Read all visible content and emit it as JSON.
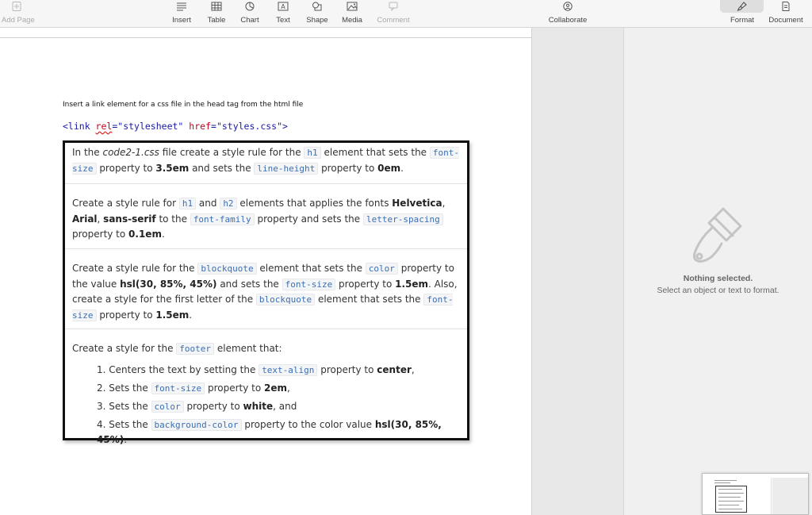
{
  "toolbar": {
    "add_page": "Add Page",
    "insert": "Insert",
    "table": "Table",
    "chart": "Chart",
    "text": "Text",
    "shape": "Shape",
    "media": "Media",
    "comment": "Comment",
    "collaborate": "Collaborate",
    "format": "Format",
    "document": "Document"
  },
  "document": {
    "instruction": "Insert a link element for a css file in the head tag from the html file",
    "code_line": {
      "open": "<link ",
      "attr1": "rel",
      "eq1": "=",
      "val1": "\"stylesheet\"",
      "space": " ",
      "attr2": "href",
      "eq2": "=",
      "val2": "\"styles.css\"",
      "close": ">"
    },
    "task1": {
      "t1": "In the ",
      "t2": "code2-1.css",
      "t3": " file create a style rule for the ",
      "c1": "h1",
      "t4": " element that sets the ",
      "c2": "font-size",
      "t5": " property to ",
      "b1": "3.5em",
      "t6": " and sets the ",
      "c3": "line-height",
      "t7": " property to ",
      "b2": "0em",
      "t8": "."
    },
    "task2": {
      "t1": "Create a style rule for ",
      "c1": "h1",
      "t2": " and ",
      "c2": "h2",
      "t3": " elements that applies the fonts ",
      "b1": "Helvetica",
      "t4": ", ",
      "b2": "Arial",
      "t5": ", ",
      "b3": "sans-serif",
      "t6": " to the ",
      "c3": "font-family",
      "t7": " property and sets the ",
      "c4": "letter-spacing",
      "t8": " property to ",
      "b4": "0.1em",
      "t9": "."
    },
    "task3": {
      "t1": "Create a style rule for the ",
      "c1": "blockquote",
      "t2": " element that sets the ",
      "c2": "color",
      "t3": " property to the value ",
      "b1": "hsl(30, 85%, 45%)",
      "t4": " and sets the ",
      "c3": "font-size",
      "t5": " property to ",
      "b2": "1.5em",
      "t6": ". Also, create a style for the first letter of the ",
      "c4": "blockquote",
      "t7": " element that sets the ",
      "c5": "font-size",
      "t8": " property to ",
      "b3": "1.5em",
      "t9": "."
    },
    "task4": {
      "t1": "Create a style for the ",
      "c1": "footer",
      "t2": " element that:",
      "steps": [
        {
          "num": "1. ",
          "t1": "Centers the text by setting the ",
          "c": "text-align",
          "t2": " property to ",
          "b": "center",
          "t3": ","
        },
        {
          "num": "2. ",
          "t1": "Sets the ",
          "c": "font-size",
          "t2": " property to ",
          "b": "2em",
          "t3": ","
        },
        {
          "num": "3. ",
          "t1": "Sets the ",
          "c": "color",
          "t2": " property to ",
          "b": "white",
          "t3": ", and"
        },
        {
          "num": "4. ",
          "t1": "Sets the ",
          "c": "background-color",
          "t2": " property to the color value ",
          "b": "hsl(30, 85%, 45%)",
          "t3": "."
        }
      ]
    }
  },
  "inspector": {
    "title": "Nothing selected.",
    "subtitle": "Select an object or text to format."
  },
  "colors": {
    "code_text": "#3c6fb4",
    "html_tag": "#1a1aa6",
    "html_attr": "#c4001f"
  }
}
